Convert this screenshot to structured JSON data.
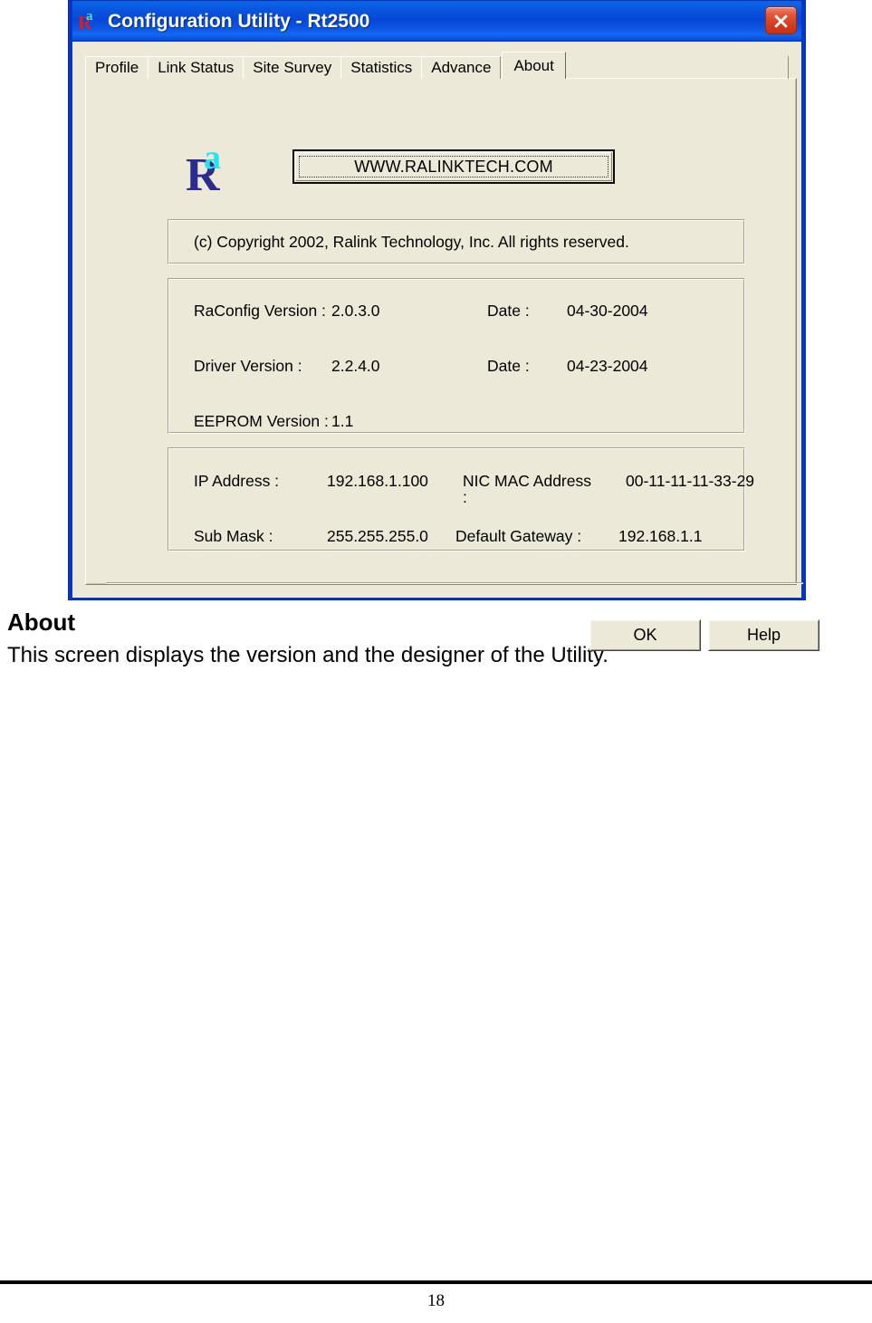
{
  "window": {
    "title": "Configuration Utility - Rt2500",
    "icon": "ralink-logo-icon",
    "close_label": "Close"
  },
  "tabs": [
    {
      "label": "Profile",
      "selected": false
    },
    {
      "label": "Link Status",
      "selected": false
    },
    {
      "label": "Site Survey",
      "selected": false
    },
    {
      "label": "Statistics",
      "selected": false
    },
    {
      "label": "Advance",
      "selected": false
    },
    {
      "label": "About",
      "selected": true
    }
  ],
  "about": {
    "logo": {
      "letter_main": "R",
      "letter_super": "a",
      "color_main": "#2c2c8f",
      "color_super": "#27e3ee"
    },
    "url_button": "WWW.RALINKTECH.COM",
    "copyright": "(c) Copyright 2002, Ralink Technology, Inc.  All rights reserved.",
    "versions": [
      {
        "label": "RaConfig Version :",
        "value": "2.0.3.0",
        "date_label": "Date :",
        "date_value": "04-30-2004"
      },
      {
        "label": "Driver Version :",
        "value": "2.2.4.0",
        "date_label": "Date :",
        "date_value": "04-23-2004"
      },
      {
        "label": "EEPROM Version :",
        "value": "1.1",
        "date_label": "",
        "date_value": ""
      }
    ],
    "network": {
      "ip_label": "IP Address :",
      "ip_value": "192.168.1.100",
      "mac_label": "NIC MAC Address",
      "mac_label_colon": ":",
      "mac_value": "00-11-11-11-33-29",
      "submask_label": "Sub Mask :",
      "submask_value": "255.255.255.0",
      "gateway_label": "Default Gateway :",
      "gateway_value": "192.168.1.1"
    }
  },
  "buttons": {
    "ok": "OK",
    "help": "Help"
  },
  "document": {
    "heading": "About",
    "paragraph": "This screen displays the version and the designer of the Utility.",
    "page_number": "18"
  },
  "colors": {
    "titlebar_blue": "#0747d8",
    "window_frame": "#0536c6",
    "client_face": "#ece9d8",
    "close_red": "#d33a1c"
  }
}
